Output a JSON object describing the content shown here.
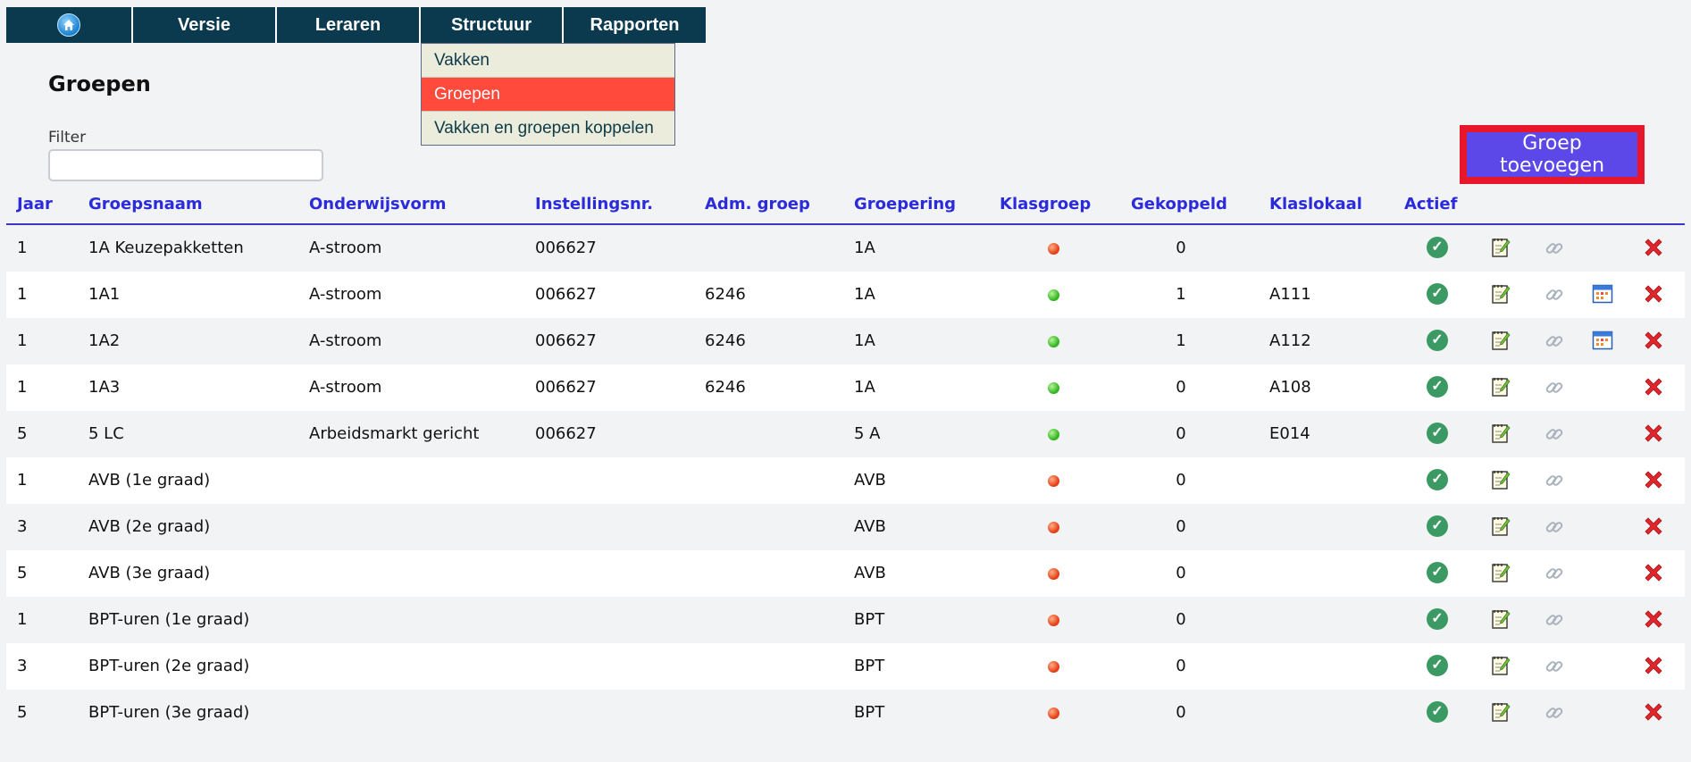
{
  "nav": {
    "items": [
      {
        "label": "Versie"
      },
      {
        "label": "Leraren"
      },
      {
        "label": "Structuur"
      },
      {
        "label": "Rapporten"
      }
    ],
    "home_icon": "home-icon",
    "bg_color": "#0b3a4f"
  },
  "dropdown": {
    "items": [
      {
        "label": "Vakken",
        "active": false
      },
      {
        "label": "Groepen",
        "active": true
      },
      {
        "label": "Vakken en groepen koppelen",
        "active": false
      }
    ],
    "active_color": "#ff4a3c"
  },
  "page": {
    "title": "Groepen",
    "filter_label": "Filter",
    "filter_value": "",
    "add_button_label": "Groep toevoegen"
  },
  "table": {
    "headers": [
      "Jaar",
      "Groepsnaam",
      "Onderwijsvorm",
      "Instellingsnr.",
      "Adm. groep",
      "Groepering",
      "Klasgroep",
      "Gekoppeld",
      "Klaslokaal",
      "Actief"
    ],
    "rows": [
      {
        "jaar": "1",
        "naam": "1A Keuzepakketten",
        "vorm": "A-stroom",
        "inst": "006627",
        "adm": "",
        "groep": "1A",
        "klas": "red",
        "gek": "0",
        "lok": "",
        "cal": false
      },
      {
        "jaar": "1",
        "naam": "1A1",
        "vorm": "A-stroom",
        "inst": "006627",
        "adm": "6246",
        "groep": "1A",
        "klas": "green",
        "gek": "1",
        "lok": "A111",
        "cal": true
      },
      {
        "jaar": "1",
        "naam": "1A2",
        "vorm": "A-stroom",
        "inst": "006627",
        "adm": "6246",
        "groep": "1A",
        "klas": "green",
        "gek": "1",
        "lok": "A112",
        "cal": true
      },
      {
        "jaar": "1",
        "naam": "1A3",
        "vorm": "A-stroom",
        "inst": "006627",
        "adm": "6246",
        "groep": "1A",
        "klas": "green",
        "gek": "0",
        "lok": "A108",
        "cal": false
      },
      {
        "jaar": "5",
        "naam": "5 LC",
        "vorm": "Arbeidsmarkt gericht",
        "inst": "006627",
        "adm": "",
        "groep": "5 A",
        "klas": "green",
        "gek": "0",
        "lok": "E014",
        "cal": false
      },
      {
        "jaar": "1",
        "naam": "AVB (1e graad)",
        "vorm": "",
        "inst": "",
        "adm": "",
        "groep": "AVB",
        "klas": "red",
        "gek": "0",
        "lok": "",
        "cal": false
      },
      {
        "jaar": "3",
        "naam": "AVB (2e graad)",
        "vorm": "",
        "inst": "",
        "adm": "",
        "groep": "AVB",
        "klas": "red",
        "gek": "0",
        "lok": "",
        "cal": false
      },
      {
        "jaar": "5",
        "naam": "AVB (3e graad)",
        "vorm": "",
        "inst": "",
        "adm": "",
        "groep": "AVB",
        "klas": "red",
        "gek": "0",
        "lok": "",
        "cal": false
      },
      {
        "jaar": "1",
        "naam": "BPT-uren (1e graad)",
        "vorm": "",
        "inst": "",
        "adm": "",
        "groep": "BPT",
        "klas": "red",
        "gek": "0",
        "lok": "",
        "cal": false
      },
      {
        "jaar": "3",
        "naam": "BPT-uren (2e graad)",
        "vorm": "",
        "inst": "",
        "adm": "",
        "groep": "BPT",
        "klas": "red",
        "gek": "0",
        "lok": "",
        "cal": false
      },
      {
        "jaar": "5",
        "naam": "BPT-uren (3e graad)",
        "vorm": "",
        "inst": "",
        "adm": "",
        "groep": "BPT",
        "klas": "red",
        "gek": "0",
        "lok": "",
        "cal": false
      }
    ],
    "row_icons": [
      "check-circle-icon",
      "edit-note-icon",
      "link-icon",
      "calendar-icon",
      "delete-x-icon"
    ],
    "header_color": "#2b2bd9"
  }
}
